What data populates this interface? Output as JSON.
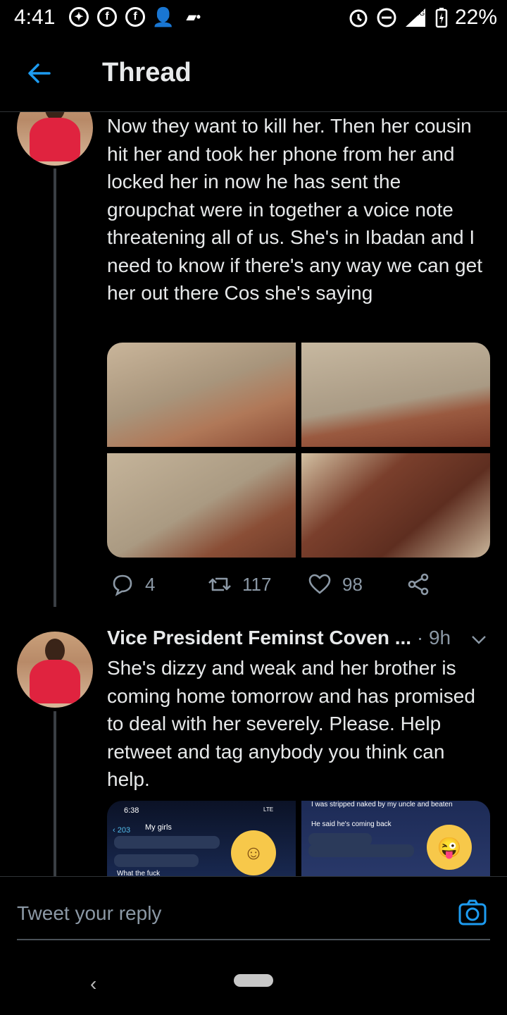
{
  "status_bar": {
    "time": "4:41",
    "network": "3G",
    "battery": "22%",
    "icons": [
      "messenger-icon",
      "facebook-icon",
      "facebook-icon",
      "add-person-icon",
      "dots-icon",
      "alarm-icon",
      "do-not-disturb-icon",
      "signal-icon",
      "battery-icon"
    ]
  },
  "header": {
    "title": "Thread",
    "back_icon": "arrow-left-icon"
  },
  "tweets": [
    {
      "text": "Now  they want to kill her. Then her cousin hit her and took her phone from her and locked her in now he has sent the groupchat were in together a voice note threatening all of us. She's in Ibadan and I need to know if there's any way we can get her out there Cos she's saying",
      "media_count": 4,
      "actions": {
        "reply": "4",
        "retweet": "117",
        "like": "98"
      }
    },
    {
      "author": "Vice President Feminst Coven ...",
      "time": "· 9h",
      "text": "She's dizzy and weak and her brother is coming home tomorrow and has promised to deal with her severely. Please. Help retweet and tag anybody you think can help.",
      "screenshot_a": {
        "time": "6:38",
        "back": "203",
        "chat": "My girls",
        "msg": "What the fuck",
        "lte": "LTE"
      },
      "screenshot_b": {
        "top": "I was stripped naked by my uncle and beaten",
        "msg": "He said he's coming back"
      }
    }
  ],
  "reply": {
    "placeholder": "Tweet your reply"
  },
  "colors": {
    "accent": "#1d9bf0",
    "background": "#000000",
    "muted": "#8b98a5"
  }
}
